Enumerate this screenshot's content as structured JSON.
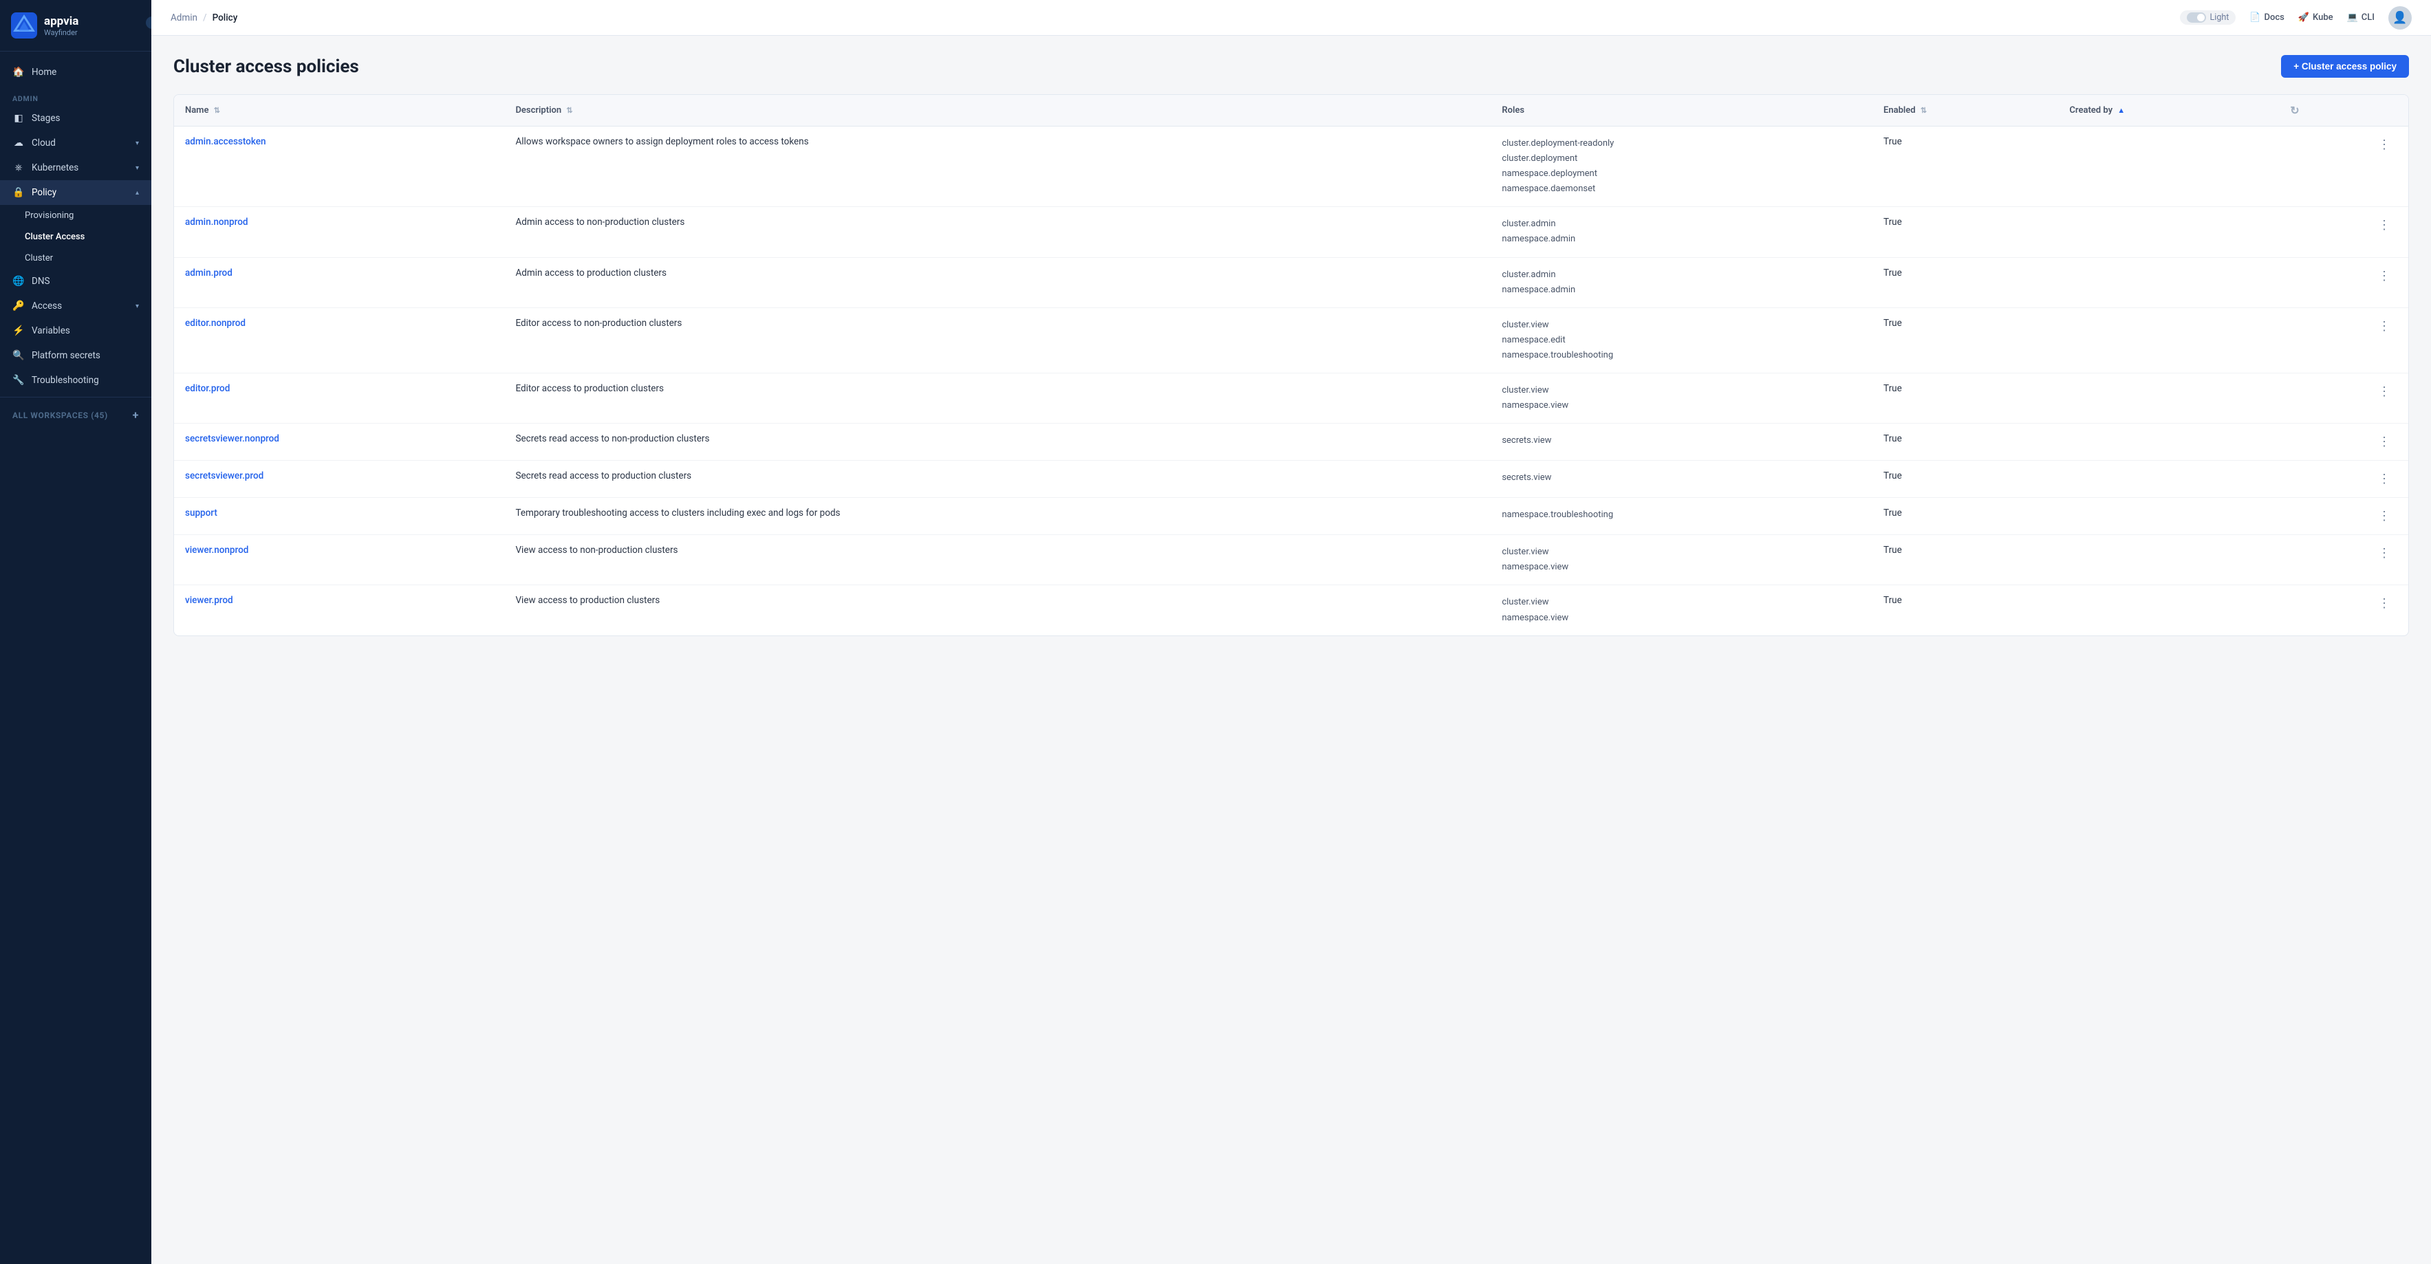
{
  "app": {
    "name": "appvia",
    "subtitle": "Wayfinder"
  },
  "topbar": {
    "breadcrumb_admin": "Admin",
    "breadcrumb_sep": "/",
    "breadcrumb_current": "Policy",
    "theme_label": "Light",
    "docs_label": "Docs",
    "kube_label": "Kube",
    "cli_label": "CLI"
  },
  "sidebar": {
    "sections": [
      {
        "type": "nav-item",
        "label": "Home",
        "icon": "🏠"
      },
      {
        "type": "section-label",
        "label": "ADMIN"
      },
      {
        "type": "nav-item",
        "label": "Stages",
        "icon": "◧"
      },
      {
        "type": "nav-item",
        "label": "Cloud",
        "icon": "☁",
        "hasArrow": true
      },
      {
        "type": "nav-item",
        "label": "Kubernetes",
        "icon": "⎈",
        "hasArrow": true
      },
      {
        "type": "nav-item",
        "label": "Policy",
        "icon": "🔒",
        "hasArrow": true,
        "active": true
      }
    ],
    "policy_sub": [
      {
        "label": "Provisioning",
        "active": false
      },
      {
        "label": "Cluster Access",
        "active": true
      },
      {
        "label": "Cluster",
        "active": false
      }
    ],
    "nav_items_2": [
      {
        "label": "DNS",
        "icon": "🌐"
      },
      {
        "label": "Access",
        "icon": "🔑",
        "hasArrow": true
      },
      {
        "label": "Variables",
        "icon": "⚡"
      },
      {
        "label": "Platform secrets",
        "icon": "🔍"
      },
      {
        "label": "Troubleshooting",
        "icon": "🔧"
      }
    ],
    "workspaces_label": "ALL WORKSPACES (45)",
    "workspaces_count": "45"
  },
  "page": {
    "title": "Cluster access policies",
    "add_button": "+ Cluster access policy"
  },
  "table": {
    "columns": [
      {
        "label": "Name",
        "sortable": true
      },
      {
        "label": "Description",
        "sortable": true
      },
      {
        "label": "Roles",
        "sortable": false
      },
      {
        "label": "Enabled",
        "sortable": true
      },
      {
        "label": "Created by",
        "sortable": true,
        "sorted": true
      }
    ],
    "rows": [
      {
        "name": "admin.accesstoken",
        "description": "Allows workspace owners to assign deployment roles to access tokens",
        "roles": [
          "cluster.deployment-readonly",
          "cluster.deployment",
          "namespace.deployment",
          "namespace.daemonset"
        ],
        "enabled": "True",
        "created_by": ""
      },
      {
        "name": "admin.nonprod",
        "description": "Admin access to non-production clusters",
        "roles": [
          "cluster.admin",
          "namespace.admin"
        ],
        "enabled": "True",
        "created_by": ""
      },
      {
        "name": "admin.prod",
        "description": "Admin access to production clusters",
        "roles": [
          "cluster.admin",
          "namespace.admin"
        ],
        "enabled": "True",
        "created_by": ""
      },
      {
        "name": "editor.nonprod",
        "description": "Editor access to non-production clusters",
        "roles": [
          "cluster.view",
          "namespace.edit",
          "namespace.troubleshooting"
        ],
        "enabled": "True",
        "created_by": ""
      },
      {
        "name": "editor.prod",
        "description": "Editor access to production clusters",
        "roles": [
          "cluster.view",
          "namespace.view"
        ],
        "enabled": "True",
        "created_by": ""
      },
      {
        "name": "secretsviewer.nonprod",
        "description": "Secrets read access to non-production clusters",
        "roles": [
          "secrets.view"
        ],
        "enabled": "True",
        "created_by": ""
      },
      {
        "name": "secretsviewer.prod",
        "description": "Secrets read access to production clusters",
        "roles": [
          "secrets.view"
        ],
        "enabled": "True",
        "created_by": ""
      },
      {
        "name": "support",
        "description": "Temporary troubleshooting access to clusters including exec and logs for pods",
        "roles": [
          "namespace.troubleshooting"
        ],
        "enabled": "True",
        "created_by": ""
      },
      {
        "name": "viewer.nonprod",
        "description": "View access to non-production clusters",
        "roles": [
          "cluster.view",
          "namespace.view"
        ],
        "enabled": "True",
        "created_by": ""
      },
      {
        "name": "viewer.prod",
        "description": "View access to production clusters",
        "roles": [
          "cluster.view",
          "namespace.view"
        ],
        "enabled": "True",
        "created_by": ""
      }
    ]
  }
}
